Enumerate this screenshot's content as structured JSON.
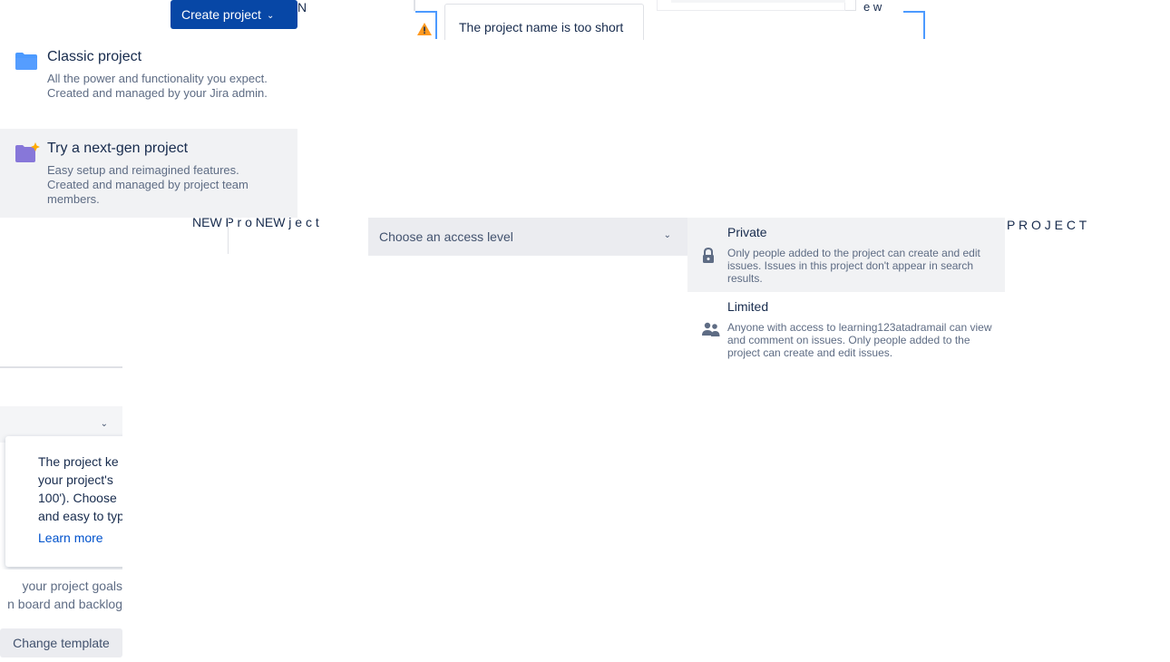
{
  "header": {
    "create_project_label": "Create project",
    "fragment_n": "N",
    "fragment_ew": "e w"
  },
  "create_menu": {
    "items": [
      {
        "title": "Classic project",
        "description": "All the power and functionality you expect. Created and managed by your Jira admin.",
        "icon": "folder-icon",
        "icon_color": "#4c9aff"
      },
      {
        "title": "Try a next-gen project",
        "description": "Easy setup and reimagined features. Created and managed by project team members.",
        "icon": "sparkle-folder-icon",
        "icon_color": "#8777d9"
      }
    ]
  },
  "validation": {
    "message": "The project name is too short",
    "icon": "warning-icon",
    "icon_color": "#ff991f"
  },
  "name_fragment": "NEW P  r o NEW j  e c t",
  "key_fragment": "P R O J E C T",
  "access": {
    "placeholder": "Choose an access level",
    "options": [
      {
        "title": "Private",
        "description": "Only people added to the project can create and edit issues. Issues in this project don't appear in search results.",
        "icon": "lock-icon"
      },
      {
        "title": "Limited",
        "description": "Anyone with access to learning123atadramail can view and comment on issues. Only people added to the project can create and edit issues.",
        "icon": "people-icon"
      }
    ]
  },
  "key_tooltip": {
    "lines": [
      "The project ke",
      "your project's",
      "100'). Choose",
      "and easy to typ"
    ],
    "learn_more": "Learn more"
  },
  "template": {
    "description_lines": [
      "your project goals",
      "n board and backlog"
    ],
    "change_label": "Change template"
  },
  "colors": {
    "primary": "#0747a6",
    "focus": "#4c9aff",
    "link": "#0052cc"
  }
}
